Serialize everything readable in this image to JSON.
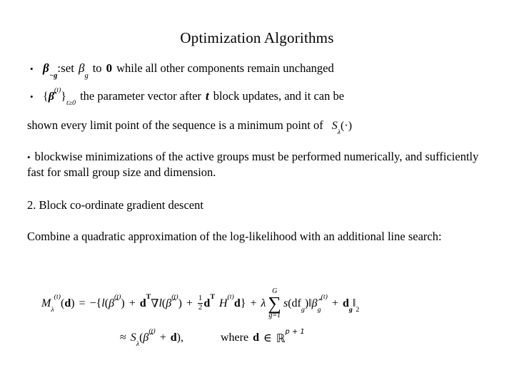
{
  "slide": {
    "title": "Optimization Algorithms",
    "bullet_glyph": "•",
    "bullets": [
      {
        "id": "bullet-beta-minus-g",
        "math_lead": "β",
        "math_lead_sub": "−g",
        "text_after_lead": ":set",
        "math_beta_g": "β",
        "math_beta_g_sub": "g",
        "text_to": "to",
        "math_zero": "0",
        "text_tail": "while all other components remain unchanged"
      },
      {
        "id": "bullet-beta-hat-sequence",
        "seq_open": "{",
        "seq_beta": "β̂",
        "seq_sup": "(t)",
        "seq_close": "}",
        "seq_sub": "t≥0",
        "text_mid": "the parameter vector after",
        "math_t": "t",
        "text_tail": "block updates, and it can be"
      }
    ],
    "continuation": {
      "id": "limit-point-line",
      "text": "shown every limit point of the sequence is a minimum point of",
      "math_S": "S",
      "math_S_sub": "λ",
      "math_S_arg": "(·)"
    },
    "bullet_blockwise": {
      "id": "bullet-blockwise",
      "glyph": "•",
      "text": "blockwise minimizations of the active groups must be performed numerically, and sufficiently fast for small group size and dimension."
    },
    "section_heading": "2. Block co-ordinate gradient descent",
    "paragraph": "Combine a quadratic approximation of the log-likelihood with an additional line search:",
    "equation": {
      "line1": {
        "lhs_M": "M",
        "lhs_sub": "λ",
        "lhs_sup": "(t)",
        "lhs_arg_open": "(",
        "lhs_arg_d": "d",
        "lhs_arg_close": ")",
        "equals": "=",
        "minus": "−",
        "brace_open": "{",
        "l_sym": "l",
        "beta_hat": "β̂",
        "sup_t": "(t)",
        "plus": "+",
        "d_bold": "d",
        "sup_T": "T",
        "nabla": "∇",
        "brace_close": "}",
        "frac_num": "1",
        "frac_den": "2",
        "H_sym": "H",
        "lambda": "λ",
        "sum_sym": "∑",
        "sum_upper": "G",
        "sum_lower": "g=1",
        "s_sym": "s",
        "df_text": "df",
        "df_sub": "g",
        "norm_bar": "‖",
        "beta_g_sub": "g",
        "d_g_sub": "g",
        "norm_sub": "2"
      },
      "line2": {
        "approx": "≈",
        "S_sym": "S",
        "S_sub": "λ",
        "open": "(",
        "beta_hat": "β̂",
        "sup_t": "(t)",
        "plus": "+",
        "d_bold": "d",
        "close": ")",
        "comma": ",",
        "where_text": "where",
        "d_bold2": "d",
        "in_sym": "∈",
        "reals": "ℝ",
        "exponent": "p + 1"
      }
    }
  }
}
